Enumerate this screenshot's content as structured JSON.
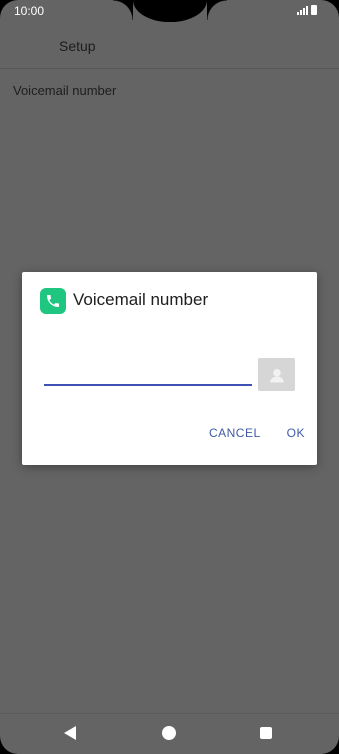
{
  "status_bar": {
    "time": "10:00",
    "signal_icon": "signal-icon",
    "battery_icon": "battery-icon"
  },
  "app_bar": {
    "title": "Setup"
  },
  "list": {
    "items": [
      {
        "label": "Voicemail number"
      }
    ]
  },
  "dialog": {
    "icon": "phone-icon",
    "icon_color": "#1fc680",
    "title": "Voicemail number",
    "input_value": "",
    "contact_button_icon": "contact-icon",
    "cancel_label": "CANCEL",
    "ok_label": "OK",
    "accent_color": "#3f51b5"
  },
  "nav_bar": {
    "back_icon": "back-triangle-icon",
    "home_icon": "home-circle-icon",
    "recents_icon": "recents-square-icon"
  }
}
